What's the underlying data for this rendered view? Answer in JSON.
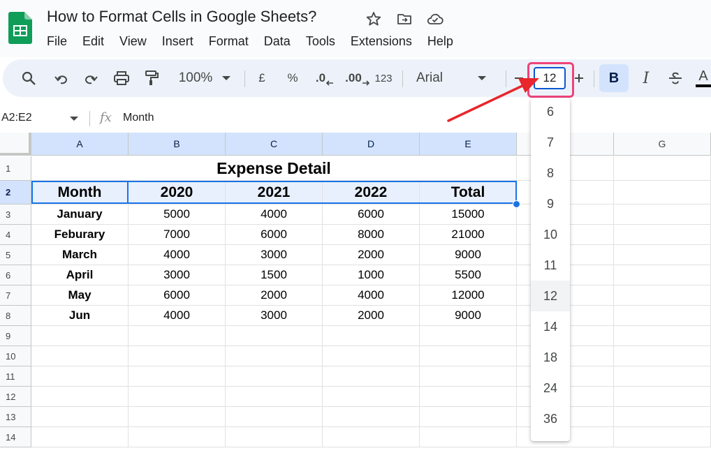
{
  "document": {
    "title": "How to Format Cells in Google Sheets?"
  },
  "menu": [
    "File",
    "Edit",
    "View",
    "Insert",
    "Format",
    "Data",
    "Tools",
    "Extensions",
    "Help"
  ],
  "toolbar": {
    "zoom": "100%",
    "currency": "£",
    "percent": "%",
    "decrease_decimal": ".0",
    "increase_decimal": ".00",
    "number_format": "123",
    "font": "Arial",
    "font_size": "12",
    "bold": "B",
    "italic": "I",
    "text_color": "A"
  },
  "formula_bar": {
    "name_box": "A2:E2",
    "fx": "fx",
    "value": "Month"
  },
  "grid": {
    "columns": [
      "A",
      "B",
      "C",
      "D",
      "E",
      "",
      "G"
    ],
    "rows": [
      "1",
      "2",
      "3",
      "4",
      "5",
      "6",
      "7",
      "8",
      "9",
      "10",
      "11",
      "12",
      "13",
      "14"
    ],
    "title": "Expense Detail",
    "header": [
      "Month",
      "2020",
      "2021",
      "2022",
      "Total"
    ],
    "data": [
      [
        "January",
        "5000",
        "4000",
        "6000",
        "15000"
      ],
      [
        "Feburary",
        "7000",
        "6000",
        "8000",
        "21000"
      ],
      [
        "March",
        "4000",
        "3000",
        "2000",
        "9000"
      ],
      [
        "April",
        "3000",
        "1500",
        "1000",
        "5500"
      ],
      [
        "May",
        "6000",
        "2000",
        "4000",
        "12000"
      ],
      [
        "Jun",
        "4000",
        "3000",
        "2000",
        "9000"
      ]
    ]
  },
  "font_size_dropdown": {
    "options": [
      "6",
      "7",
      "8",
      "9",
      "10",
      "11",
      "12",
      "14",
      "18",
      "24",
      "36"
    ],
    "selected": "12"
  },
  "colors": {
    "accent": "#1a73e8",
    "highlight": "#f0437a",
    "arrow": "#e8262c",
    "sheets_green": "#0f9d58"
  }
}
